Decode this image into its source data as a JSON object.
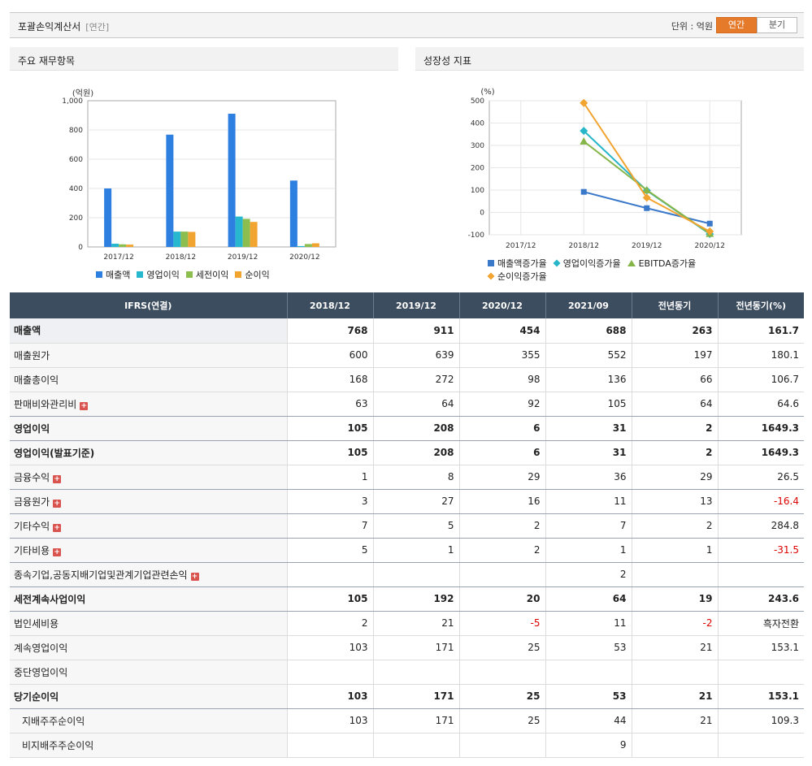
{
  "header": {
    "title": "포괄손익계산서",
    "subtitle": "[연간]",
    "unit_label": "단위 : 억원",
    "toggle": [
      "연간",
      "분기"
    ]
  },
  "left_panel": {
    "title": "주요 재무항목"
  },
  "right_panel": {
    "title": "성장성 지표"
  },
  "chart_data": [
    {
      "type": "bar",
      "unit": "(억원)",
      "categories": [
        "2017/12",
        "2018/12",
        "2019/12",
        "2020/12"
      ],
      "ylim": [
        0,
        1000
      ],
      "yticks": [
        "0",
        "200",
        "400",
        "600",
        "800",
        "1,000"
      ],
      "grid": true,
      "legend_position": "bottom",
      "series": [
        {
          "name": "매출액",
          "color": "#2d7fe0",
          "values": [
            400,
            768,
            911,
            454
          ]
        },
        {
          "name": "영업이익",
          "color": "#27b8d0",
          "values": [
            22,
            105,
            208,
            6
          ]
        },
        {
          "name": "세전이익",
          "color": "#8cbd4f",
          "values": [
            18,
            105,
            192,
            20
          ]
        },
        {
          "name": "순이익",
          "color": "#f2a431",
          "values": [
            16,
            103,
            171,
            25
          ]
        }
      ]
    },
    {
      "type": "line",
      "unit": "(%)",
      "categories": [
        "2017/12",
        "2018/12",
        "2019/12",
        "2020/12"
      ],
      "ylim": [
        -100,
        500
      ],
      "yticks": [
        "-100",
        "0",
        "100",
        "200",
        "300",
        "400",
        "500"
      ],
      "grid": true,
      "legend_position": "bottom",
      "series": [
        {
          "name": "매출액증가율",
          "color": "#3a78c9",
          "marker": "square",
          "values": [
            null,
            92,
            19,
            -50
          ]
        },
        {
          "name": "영업이익증가율",
          "color": "#26b5c9",
          "marker": "diamond",
          "values": [
            null,
            365,
            98,
            -97
          ]
        },
        {
          "name": "EBITDA증가율",
          "color": "#86b54a",
          "marker": "triangle",
          "values": [
            null,
            318,
            100,
            -95
          ]
        },
        {
          "name": "순이익증가율",
          "color": "#f2a431",
          "marker": "diamond",
          "values": [
            null,
            490,
            66,
            -85
          ]
        }
      ]
    }
  ],
  "table": {
    "columns": [
      "IFRS(연결)",
      "2018/12",
      "2019/12",
      "2020/12",
      "2021/09",
      "전년동기",
      "전년동기(%)"
    ],
    "rows": [
      {
        "label": "매출액",
        "bold": true,
        "values": [
          "768",
          "911",
          "454",
          "688",
          "263",
          "161.7"
        ]
      },
      {
        "label": "매출원가",
        "values": [
          "600",
          "639",
          "355",
          "552",
          "197",
          "180.1"
        ]
      },
      {
        "label": "매출총이익",
        "values": [
          "168",
          "272",
          "98",
          "136",
          "66",
          "106.7"
        ]
      },
      {
        "label": "판매비와관리비",
        "expand": true,
        "values": [
          "63",
          "64",
          "92",
          "105",
          "64",
          "64.6"
        ]
      },
      {
        "label": "영업이익",
        "bold": true,
        "values": [
          "105",
          "208",
          "6",
          "31",
          "2",
          "1649.3"
        ]
      },
      {
        "label": "영업이익(발표기준)",
        "bold": true,
        "values": [
          "105",
          "208",
          "6",
          "31",
          "2",
          "1649.3"
        ]
      },
      {
        "label": "금융수익",
        "expand": true,
        "values": [
          "1",
          "8",
          "29",
          "36",
          "29",
          "26.5"
        ]
      },
      {
        "label": "금융원가",
        "expand": true,
        "values": [
          "3",
          "27",
          "16",
          "11",
          "13",
          "-16.4"
        ]
      },
      {
        "label": "기타수익",
        "expand": true,
        "values": [
          "7",
          "5",
          "2",
          "7",
          "2",
          "284.8"
        ]
      },
      {
        "label": "기타비용",
        "expand": true,
        "values": [
          "5",
          "1",
          "2",
          "1",
          "1",
          "-31.5"
        ]
      },
      {
        "label": "종속기업,공동지배기업및관계기업관련손익",
        "expand": true,
        "values": [
          "",
          "",
          "",
          "2",
          "",
          ""
        ]
      },
      {
        "label": "세전계속사업이익",
        "bold": true,
        "values": [
          "105",
          "192",
          "20",
          "64",
          "19",
          "243.6"
        ]
      },
      {
        "label": "법인세비용",
        "values": [
          "2",
          "21",
          "-5",
          "11",
          "-2",
          "흑자전환"
        ]
      },
      {
        "label": "계속영업이익",
        "values": [
          "103",
          "171",
          "25",
          "53",
          "21",
          "153.1"
        ]
      },
      {
        "label": "중단영업이익",
        "values": [
          "",
          "",
          "",
          "",
          "",
          ""
        ]
      },
      {
        "label": "당기순이익",
        "bold": true,
        "values": [
          "103",
          "171",
          "25",
          "53",
          "21",
          "153.1"
        ]
      },
      {
        "label": "지배주주순이익",
        "indent": true,
        "values": [
          "103",
          "171",
          "25",
          "44",
          "21",
          "109.3"
        ]
      },
      {
        "label": "비지배주주순이익",
        "indent": true,
        "values": [
          "",
          "",
          "",
          "9",
          "",
          ""
        ]
      }
    ]
  }
}
